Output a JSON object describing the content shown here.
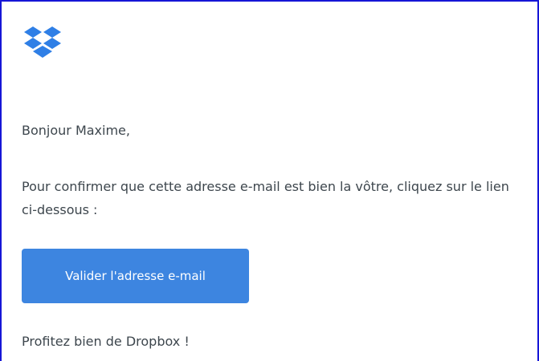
{
  "email": {
    "logo_icon": "dropbox-logo-icon",
    "greeting": "Bonjour Maxime,",
    "body": "Pour confirmer que cette adresse e-mail est bien la vôtre, cliquez sur le lien ci-dessous :",
    "button_label": "Valider l'adresse e-mail",
    "signoff": "Profitez bien de Dropbox !"
  },
  "colors": {
    "accent": "#3d85e0",
    "logo": "#2f7fe6",
    "frame_border": "#1616d6",
    "text": "#3d464d"
  }
}
